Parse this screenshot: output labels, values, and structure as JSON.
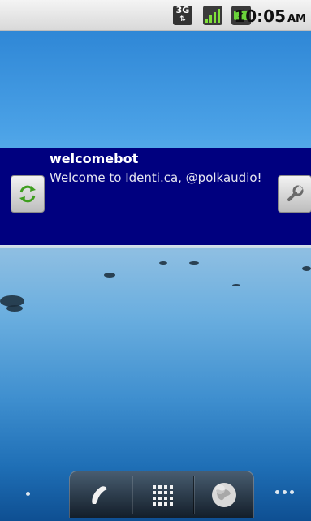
{
  "status_bar": {
    "network": "3G",
    "time": "10:05",
    "ampm": "AM"
  },
  "widget": {
    "username": "welcomebot",
    "message": "Welcome to Identi.ca, @polkaudio!",
    "background_color": "#00007f"
  },
  "icons": {
    "refresh": "refresh-icon",
    "settings": "wrench-icon",
    "phone": "phone-icon",
    "apps": "app-grid-icon",
    "browser": "globe-icon"
  }
}
